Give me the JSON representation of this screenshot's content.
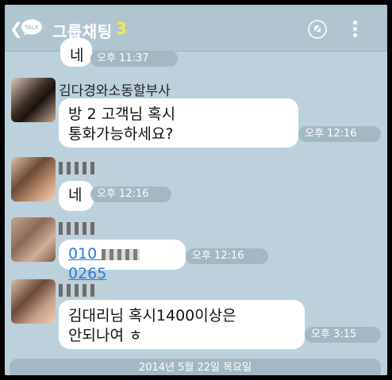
{
  "header": {
    "back_icon": "chevron-left",
    "logo_text": "TALK",
    "title": "그룹채팅",
    "member_count": "3",
    "colors": {
      "count": "#f4e84a",
      "bar": "#b1c5d1"
    }
  },
  "messages": [
    {
      "text": "네",
      "time": "오후 11:37",
      "partial": true
    },
    {
      "sender": "김다경와소동할부사",
      "text_line1": "방  2 고객님 혹시",
      "text_line2": "통화가능하세요?",
      "time": "오후 12:16"
    },
    {
      "sender": "",
      "text": "네",
      "time": "오후 12:16"
    },
    {
      "sender": "",
      "link_start": "010",
      "link_end": "0265",
      "time": "오후 12:16"
    },
    {
      "sender": "",
      "text_line1": "김대리님 혹시1400이상은",
      "text_line2": "안되나여 ㅎ",
      "time": "오후 3:15"
    }
  ],
  "date_divider": "2014년 5월 22일 목요일"
}
